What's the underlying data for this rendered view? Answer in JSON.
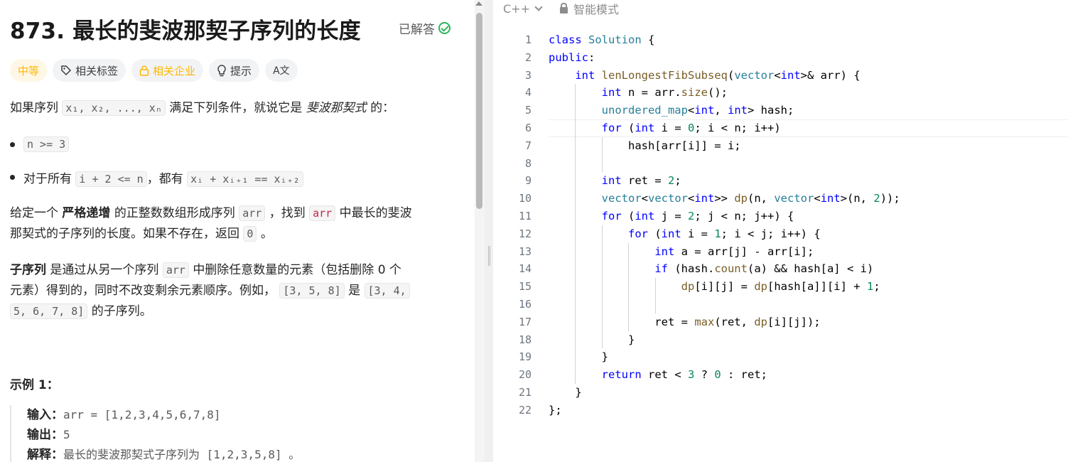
{
  "problem": {
    "title": "873. 最长的斐波那契子序列的长度",
    "solved_label": "已解答",
    "tags": {
      "difficulty": "中等",
      "related_tags": "相关标签",
      "related_companies": "相关企业",
      "hint": "提示",
      "translate": "A文"
    },
    "intro": {
      "prefix": "如果序列",
      "sequence": "x₁, x₂, ..., xₙ",
      "middle": "满足下列条件，就说它是",
      "term": "斐波那契式",
      "suffix": "的："
    },
    "conditions": [
      {
        "prefix": "",
        "code": "n >= 3",
        "mid": "",
        "code2": ""
      },
      {
        "prefix": "对于所有",
        "code": "i + 2 <= n",
        "mid": "，都有",
        "code2": "xᵢ + xᵢ₊₁ == xᵢ₊₂"
      }
    ],
    "task": {
      "p1": "给定一个",
      "strong": "严格递增",
      "p2": "的正整数数组形成序列",
      "code1": "arr",
      "p3": "，找到",
      "code2": "arr",
      "p4": "中最长的斐波",
      "line2": "那契式的子序列的长度。如果不存在，返回",
      "code3": "0",
      "p5": "。"
    },
    "subseq": {
      "strong": "子序列",
      "p1": "是通过从另一个序列",
      "code1": "arr",
      "p2": "中删除任意数量的元素（包括删除 0 个",
      "line2": "元素）得到的，同时不改变剩余元素顺序。例如，",
      "code2": "[3, 5, 8]",
      "p3": "是",
      "code3": "[3, 4,",
      "code4": "5, 6, 7, 8]",
      "p4": "的子序列。"
    },
    "example": {
      "title": "示例 1：",
      "input_label": "输入：",
      "input_value": "arr = [1,2,3,4,5,6,7,8]",
      "output_label": "输出：",
      "output_value": "5",
      "explain_label": "解释：",
      "explain_value": "最长的斐波那契式子序列为 [1,2,3,5,8] 。"
    }
  },
  "editor": {
    "language": "C++",
    "mode": "智能模式",
    "active_line": 6,
    "lines": [
      "class Solution {",
      "public:",
      "    int lenLongestFibSubseq(vector<int>& arr) {",
      "        int n = arr.size();",
      "        unordered_map<int, int> hash;",
      "        for (int i = 0; i < n; i++)",
      "            hash[arr[i]] = i;",
      "",
      "        int ret = 2;",
      "        vector<vector<int>> dp(n, vector<int>(n, 2));",
      "        for (int j = 2; j < n; j++) {",
      "            for (int i = 1; i < j; i++) {",
      "                int a = arr[j] - arr[i];",
      "                if (hash.count(a) && hash[a] < i)",
      "                    dp[i][j] = dp[hash[a]][i] + 1;",
      "",
      "                ret = max(ret, dp[i][j]);",
      "            }",
      "        }",
      "        return ret < 3 ? 0 : ret;",
      "    }",
      "};"
    ]
  }
}
